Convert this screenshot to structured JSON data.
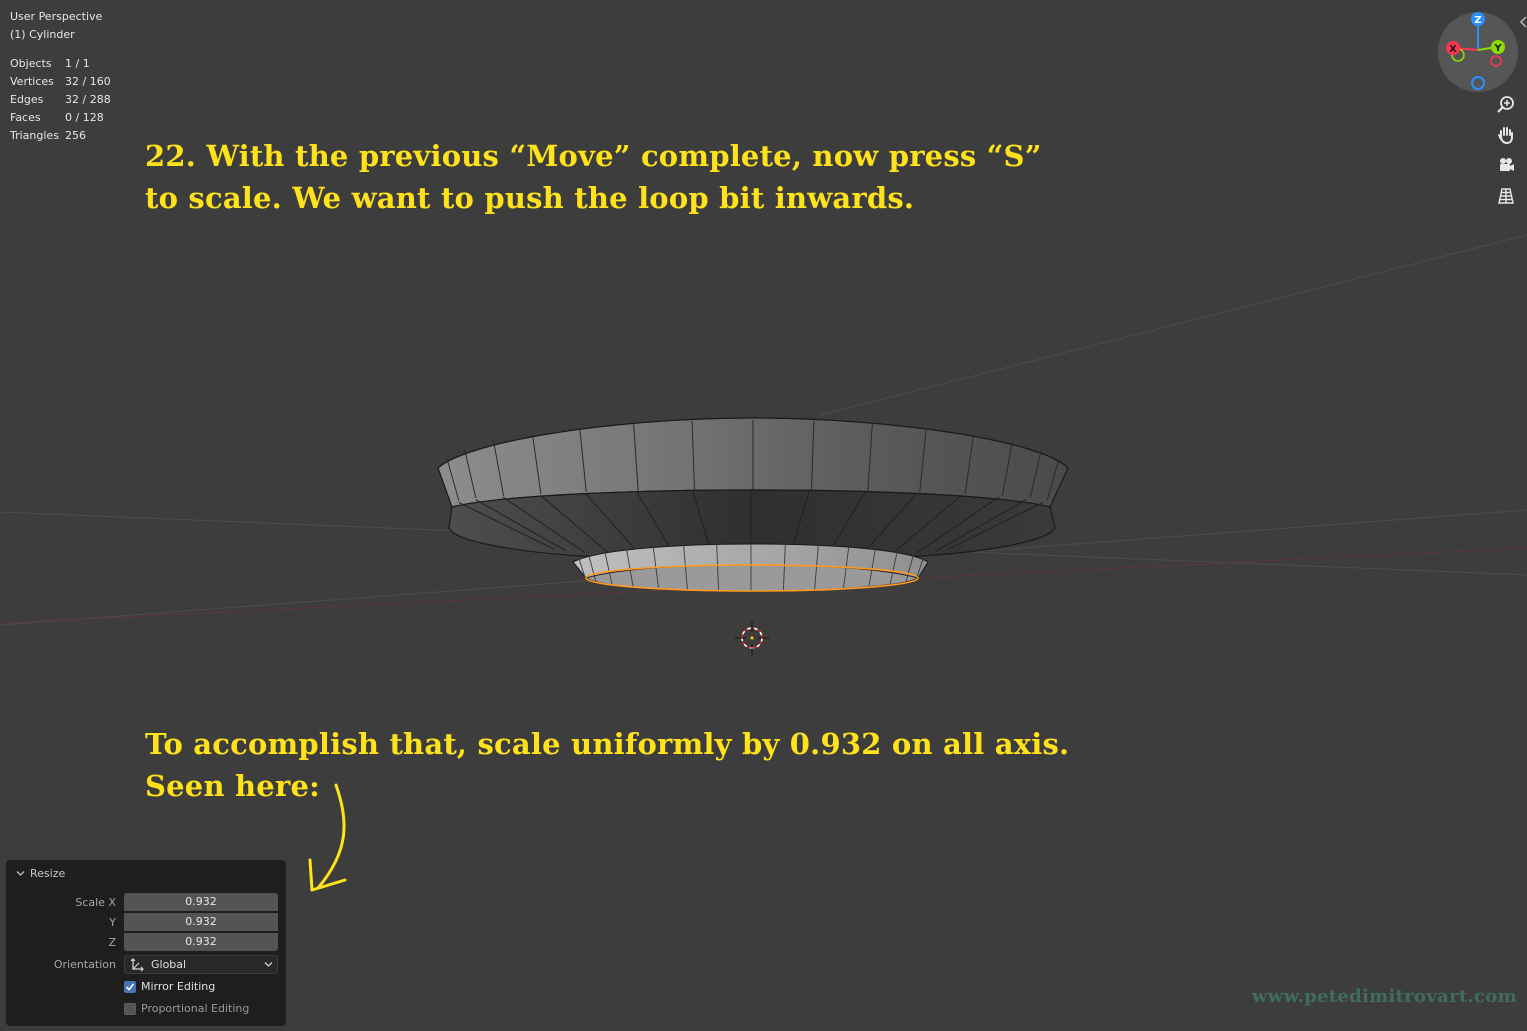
{
  "viewport": {
    "view_name": "User Perspective",
    "object_label": "(1) Cylinder",
    "stats": [
      {
        "label": "Objects",
        "value": "1 / 1"
      },
      {
        "label": "Vertices",
        "value": "32 / 160"
      },
      {
        "label": "Edges",
        "value": "32 / 288"
      },
      {
        "label": "Faces",
        "value": "0 / 128"
      },
      {
        "label": "Triangles",
        "value": "256"
      }
    ]
  },
  "annotations": {
    "top_line1": "22. With the previous “Move” complete, now press “S”",
    "top_line2": "to scale. We want to push the loop bit inwards.",
    "bottom_line1": "To accomplish that, scale uniformly by 0.932 on all axis.",
    "bottom_line2": "Seen here:"
  },
  "gizmo": {
    "z_label": "Z",
    "x_label": "X",
    "y_label": "Y",
    "colors": {
      "x": "#ff3352",
      "y": "#8bdc00",
      "z": "#2890ff"
    }
  },
  "nav_icons": [
    "zoom-icon",
    "hand-pan-icon",
    "camera-icon",
    "grid-ortho-icon"
  ],
  "resize_panel": {
    "title": "Resize",
    "scale_x_label": "Scale X",
    "scale_x": "0.932",
    "y_label": "Y",
    "scale_y": "0.932",
    "z_label": "Z",
    "scale_z": "0.932",
    "orientation_label": "Orientation",
    "orientation_value": "Global",
    "mirror_label": "Mirror Editing",
    "mirror_checked": true,
    "proportional_label": "Proportional Editing",
    "proportional_checked": false
  },
  "colors": {
    "annotation": "#ffe21a",
    "selection": "#ff9a1f",
    "background": "#3d3d3d",
    "checkbox_active": "#4772b3"
  },
  "watermark": "www.petedimitrovart.com"
}
